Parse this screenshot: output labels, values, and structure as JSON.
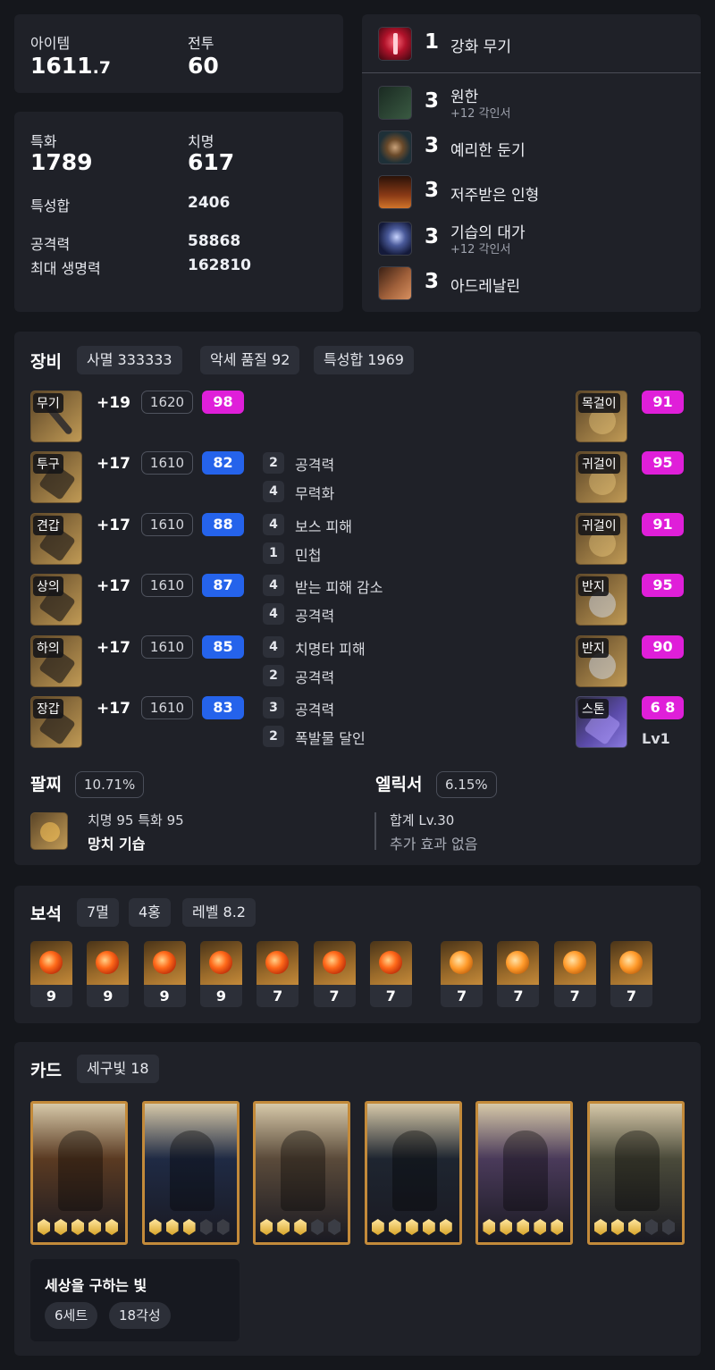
{
  "summary": {
    "item_label": "아이템",
    "item_main": "1611",
    "item_frac": ".7",
    "combat_label": "전투",
    "combat_value": "60"
  },
  "stats": {
    "spec_label": "특화",
    "spec_value": "1789",
    "crit_label": "치명",
    "crit_value": "617",
    "total_label": "특성합",
    "total_value": "2406",
    "atk_label": "공격력",
    "atk_value": "58868",
    "hp_label": "최대 생명력",
    "hp_value": "162810"
  },
  "engravings": {
    "top": {
      "level": "1",
      "name": "강화 무기",
      "icon": "red-weapon-icon",
      "color": "#b0122a"
    },
    "items": [
      {
        "level": "3",
        "name": "원한",
        "sub": "+12 각인서",
        "icon": "grudge-icon",
        "color": "#2a4a3a"
      },
      {
        "level": "3",
        "name": "예리한 둔기",
        "sub": "",
        "icon": "keen-blunt-icon",
        "color": "#2a3d45"
      },
      {
        "level": "3",
        "name": "저주받은 인형",
        "sub": "",
        "icon": "cursed-doll-icon",
        "color": "#7a2a12"
      },
      {
        "level": "3",
        "name": "기습의 대가",
        "sub": "+12 각인서",
        "icon": "ambush-master-icon",
        "color": "#2a2f5a"
      },
      {
        "level": "3",
        "name": "아드레날린",
        "sub": "",
        "icon": "adrenaline-icon",
        "color": "#6a3a22"
      }
    ]
  },
  "equipment": {
    "title": "장비",
    "tags": [
      "사멸 333333",
      "악세 품질 92",
      "특성합 1969"
    ],
    "gear": [
      {
        "slot": "무기",
        "plus": "+19",
        "level": "1620",
        "quality": "98",
        "qcolor": "mag",
        "tripods": []
      },
      {
        "slot": "투구",
        "plus": "+17",
        "level": "1610",
        "quality": "82",
        "qcolor": "blu",
        "tripods": [
          {
            "n": "2",
            "t": "공격력"
          },
          {
            "n": "4",
            "t": "무력화"
          }
        ]
      },
      {
        "slot": "견갑",
        "plus": "+17",
        "level": "1610",
        "quality": "88",
        "qcolor": "blu",
        "tripods": [
          {
            "n": "4",
            "t": "보스 피해"
          },
          {
            "n": "1",
            "t": "민첩"
          }
        ]
      },
      {
        "slot": "상의",
        "plus": "+17",
        "level": "1610",
        "quality": "87",
        "qcolor": "blu",
        "tripods": [
          {
            "n": "4",
            "t": "받는 피해 감소"
          },
          {
            "n": "4",
            "t": "공격력"
          }
        ]
      },
      {
        "slot": "하의",
        "plus": "+17",
        "level": "1610",
        "quality": "85",
        "qcolor": "blu",
        "tripods": [
          {
            "n": "4",
            "t": "치명타 피해"
          },
          {
            "n": "2",
            "t": "공격력"
          }
        ]
      },
      {
        "slot": "장갑",
        "plus": "+17",
        "level": "1610",
        "quality": "83",
        "qcolor": "blu",
        "tripods": [
          {
            "n": "3",
            "t": "공격력"
          },
          {
            "n": "2",
            "t": "폭발물 달인"
          }
        ]
      }
    ],
    "accessories": [
      {
        "slot": "목걸이",
        "quality": "91"
      },
      {
        "slot": "귀걸이",
        "quality": "95"
      },
      {
        "slot": "귀걸이",
        "quality": "91"
      },
      {
        "slot": "반지",
        "quality": "95"
      },
      {
        "slot": "반지",
        "quality": "90"
      },
      {
        "slot": "스톤",
        "quality": "6 8",
        "extra": "Lv1"
      }
    ],
    "bracelet": {
      "label": "팔찌",
      "pct": "10.71%",
      "stats": "치명 95  특화 95",
      "effects": "망치  기습"
    },
    "elixir": {
      "label": "엘릭서",
      "pct": "6.15%",
      "total": "합계 Lv.30",
      "extra": "추가 효과 없음"
    }
  },
  "gems": {
    "title": "보석",
    "tags": [
      "7멸",
      "4홍",
      "레벨 8.2"
    ],
    "items": [
      {
        "level": "9",
        "type": "red"
      },
      {
        "level": "9",
        "type": "red"
      },
      {
        "level": "9",
        "type": "red"
      },
      {
        "level": "9",
        "type": "red"
      },
      {
        "level": "7",
        "type": "red"
      },
      {
        "level": "7",
        "type": "red"
      },
      {
        "level": "7",
        "type": "red"
      },
      {
        "level": "7",
        "type": "org"
      },
      {
        "level": "7",
        "type": "org"
      },
      {
        "level": "7",
        "type": "org"
      },
      {
        "level": "7",
        "type": "org"
      }
    ]
  },
  "cards": {
    "title": "카드",
    "tag": "세구빛 18",
    "list": [
      {
        "awaken": 5,
        "color": "#5a3a22"
      },
      {
        "awaken": 3,
        "color": "#1f2a44"
      },
      {
        "awaken": 3,
        "color": "#5a4a3a"
      },
      {
        "awaken": 5,
        "color": "#1e2530"
      },
      {
        "awaken": 5,
        "color": "#4a3a5a"
      },
      {
        "awaken": 3,
        "color": "#4a4a3a"
      }
    ],
    "set": {
      "name": "세상을 구하는 빛",
      "count": "6세트",
      "awaken": "18각성"
    }
  }
}
